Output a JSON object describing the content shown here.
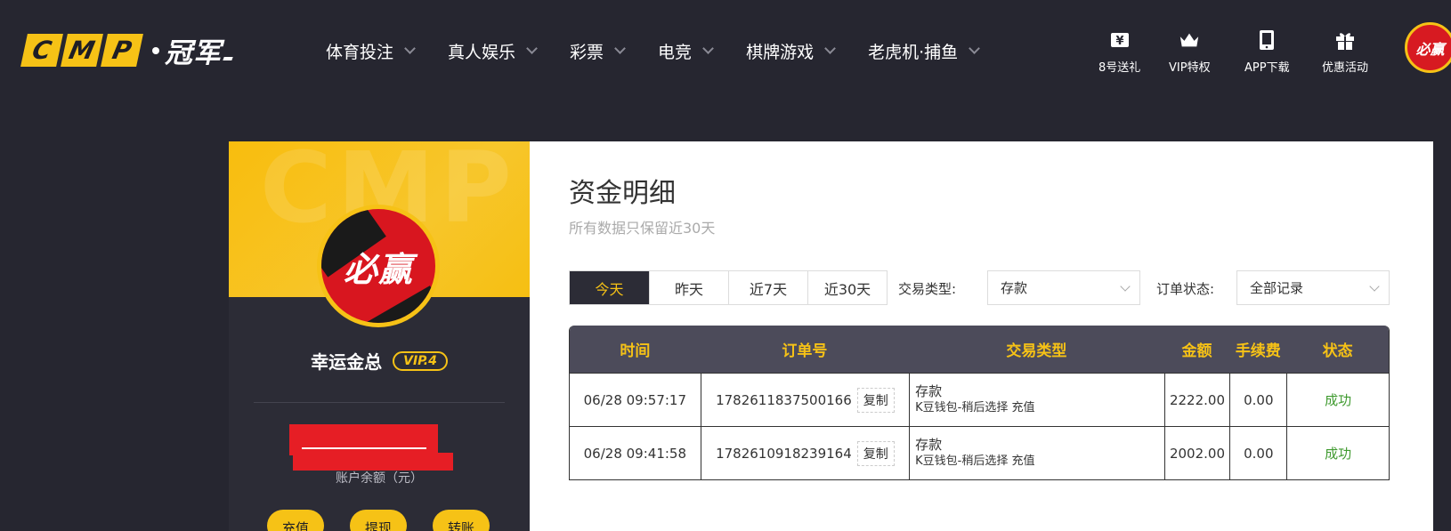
{
  "header": {
    "logo_letters": [
      "C",
      "M",
      "P"
    ],
    "logo_cn": "冠军",
    "nav": [
      {
        "label": "体育投注"
      },
      {
        "label": "真人娱乐"
      },
      {
        "label": "彩票"
      },
      {
        "label": "电竞"
      },
      {
        "label": "棋牌游戏"
      },
      {
        "label": "老虎机·捕鱼"
      }
    ],
    "quick": [
      {
        "label": "8号送礼",
        "icon": "yen-ticket-icon"
      },
      {
        "label": "VIP特权",
        "icon": "crown-icon"
      },
      {
        "label": "APP下载",
        "icon": "phone-icon"
      },
      {
        "label": "优惠活动",
        "icon": "gift-icon"
      }
    ],
    "avatar_text": "必赢"
  },
  "profile": {
    "banner_watermark": "CMP",
    "avatar_text": "必赢",
    "username": "幸运金总",
    "vip": "VIP.4",
    "balance_label": "账户余额（元）",
    "buttons": [
      "充值",
      "提现",
      "转账"
    ]
  },
  "content": {
    "title": "资金明细",
    "subtitle": "所有数据只保留近30天",
    "date_tabs": [
      "今天",
      "昨天",
      "近7天",
      "近30天"
    ],
    "filters": {
      "type_label": "交易类型:",
      "type_value": "存款",
      "status_label": "订单状态:",
      "status_value": "全部记录"
    },
    "table": {
      "headers": [
        "时间",
        "订单号",
        "交易类型",
        "金额",
        "手续费",
        "状态"
      ],
      "copy_label": "复制",
      "rows": [
        {
          "time": "06/28 09:57:17",
          "order": "1782611837500166",
          "type": "存款",
          "type_detail": "K豆钱包-稍后选择 充值",
          "amount": "2222.00",
          "fee": "0.00",
          "status": "成功"
        },
        {
          "time": "06/28 09:41:58",
          "order": "1782610918239164",
          "type": "存款",
          "type_detail": "K豆钱包-稍后选择 充值",
          "amount": "2002.00",
          "fee": "0.00",
          "status": "成功"
        }
      ]
    }
  },
  "colors": {
    "accent": "#f6c216",
    "dark_bg": "#262630",
    "table_header": "#4c4b5a",
    "success": "#3f9a2f",
    "redact": "#e61e25"
  }
}
